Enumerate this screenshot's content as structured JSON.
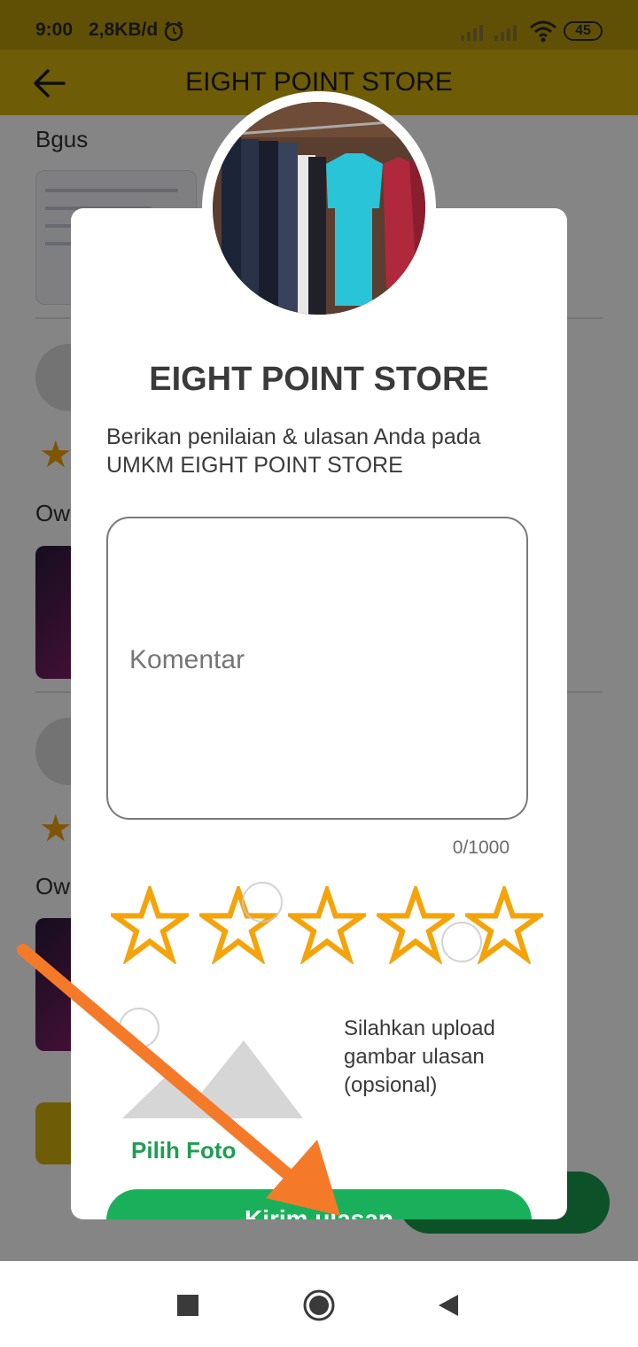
{
  "status_bar": {
    "time": "9:00",
    "network_speed": "2,8KB/d",
    "battery": "45"
  },
  "app_bar": {
    "title": "EIGHT POINT STORE"
  },
  "background": {
    "review_text_1": "Bgus",
    "review_text_2": "Ow",
    "review_text_3": "Ow"
  },
  "dialog": {
    "store_name": "EIGHT POINT STORE",
    "instruction": "Berikan penilaian & ulasan Anda pada UMKM EIGHT POINT STORE",
    "comment_placeholder": "Komentar",
    "char_count": "0/1000",
    "rating": {
      "selected": 0,
      "max": 5
    },
    "pick_photo_label": "Pilih Foto",
    "upload_note": "Silahkan upload gambar ulasan (opsional)",
    "send_button_label": "Kirim ulasan"
  },
  "colors": {
    "app_bar": "#d4b00d",
    "star_outline": "#f4a40a",
    "send_button": "#1ab05b",
    "pick_photo_text": "#1e9e52",
    "annotation_arrow": "#f47a2a"
  },
  "icons": {
    "back": "arrow-left-icon",
    "alarm": "alarm-clock-icon",
    "wifi": "wifi-icon",
    "nav_recent": "square-icon",
    "nav_home": "circle-icon",
    "nav_back": "triangle-back-icon"
  }
}
